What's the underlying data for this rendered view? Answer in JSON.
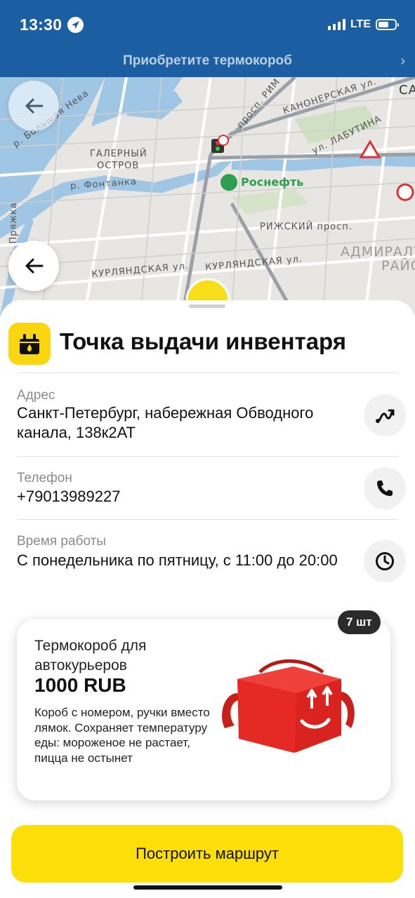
{
  "status_bar": {
    "time": "13:30",
    "network": "LTE"
  },
  "banner": {
    "text": "Приобретите термокороб",
    "chevron": "›"
  },
  "map": {
    "labels": {
      "bolshaya_neva": "р. Большая Нева",
      "galerny": "ГАЛЕРНЫЙ",
      "ostrov": "ОСТРОВ",
      "fontanka": "р. Фонтанка",
      "pryazhka": "р. Пряжка",
      "rimsky": "просп. РИМ",
      "kanonerskaya": "КАНОНЕРСКАЯ ул.",
      "labutina": "ул. ЛАБУТИНА",
      "rosneft": "Роснефть",
      "rizhsky": "РИЖСКИЙ просп.",
      "kurlyandskaya_1": "КУРЛЯНДСКАЯ ул.",
      "kurlyandskaya_2": "КУРЛЯНДСКАЯ ул.",
      "admiralt": "АДМИРАЛТ",
      "raion": "РАЙО",
      "sa": "СА"
    }
  },
  "sheet": {
    "title": "Точка выдачи инвентаря",
    "address": {
      "label": "Адрес",
      "value": "Санкт-Петербург, набережная Обводного канала, 138к2АТ"
    },
    "phone": {
      "label": "Телефон",
      "value": "+79013989227"
    },
    "hours": {
      "label": "Время работы",
      "value": "С понедельника по пятницу, с 11:00 до 20:00"
    }
  },
  "product": {
    "name": "Термокороб для автокурьеров",
    "price": "1000 RUB",
    "description": "Короб с номером, ручки вместо лямок. Сохраняет температуру еды: мороженое не растает, пицца не остынет",
    "quantity": "7 шт"
  },
  "route_button": {
    "label": "Построить маршрут"
  },
  "colors": {
    "accent_yellow": "#fcde09",
    "banner_blue": "#1b5ea1",
    "box_red": "#e52a25"
  },
  "icons": {
    "location": "location-arrow-icon",
    "back": "arrow-left-icon",
    "title": "inventory-box-icon",
    "route": "route-icon",
    "phone": "phone-icon",
    "clock": "clock-icon"
  }
}
